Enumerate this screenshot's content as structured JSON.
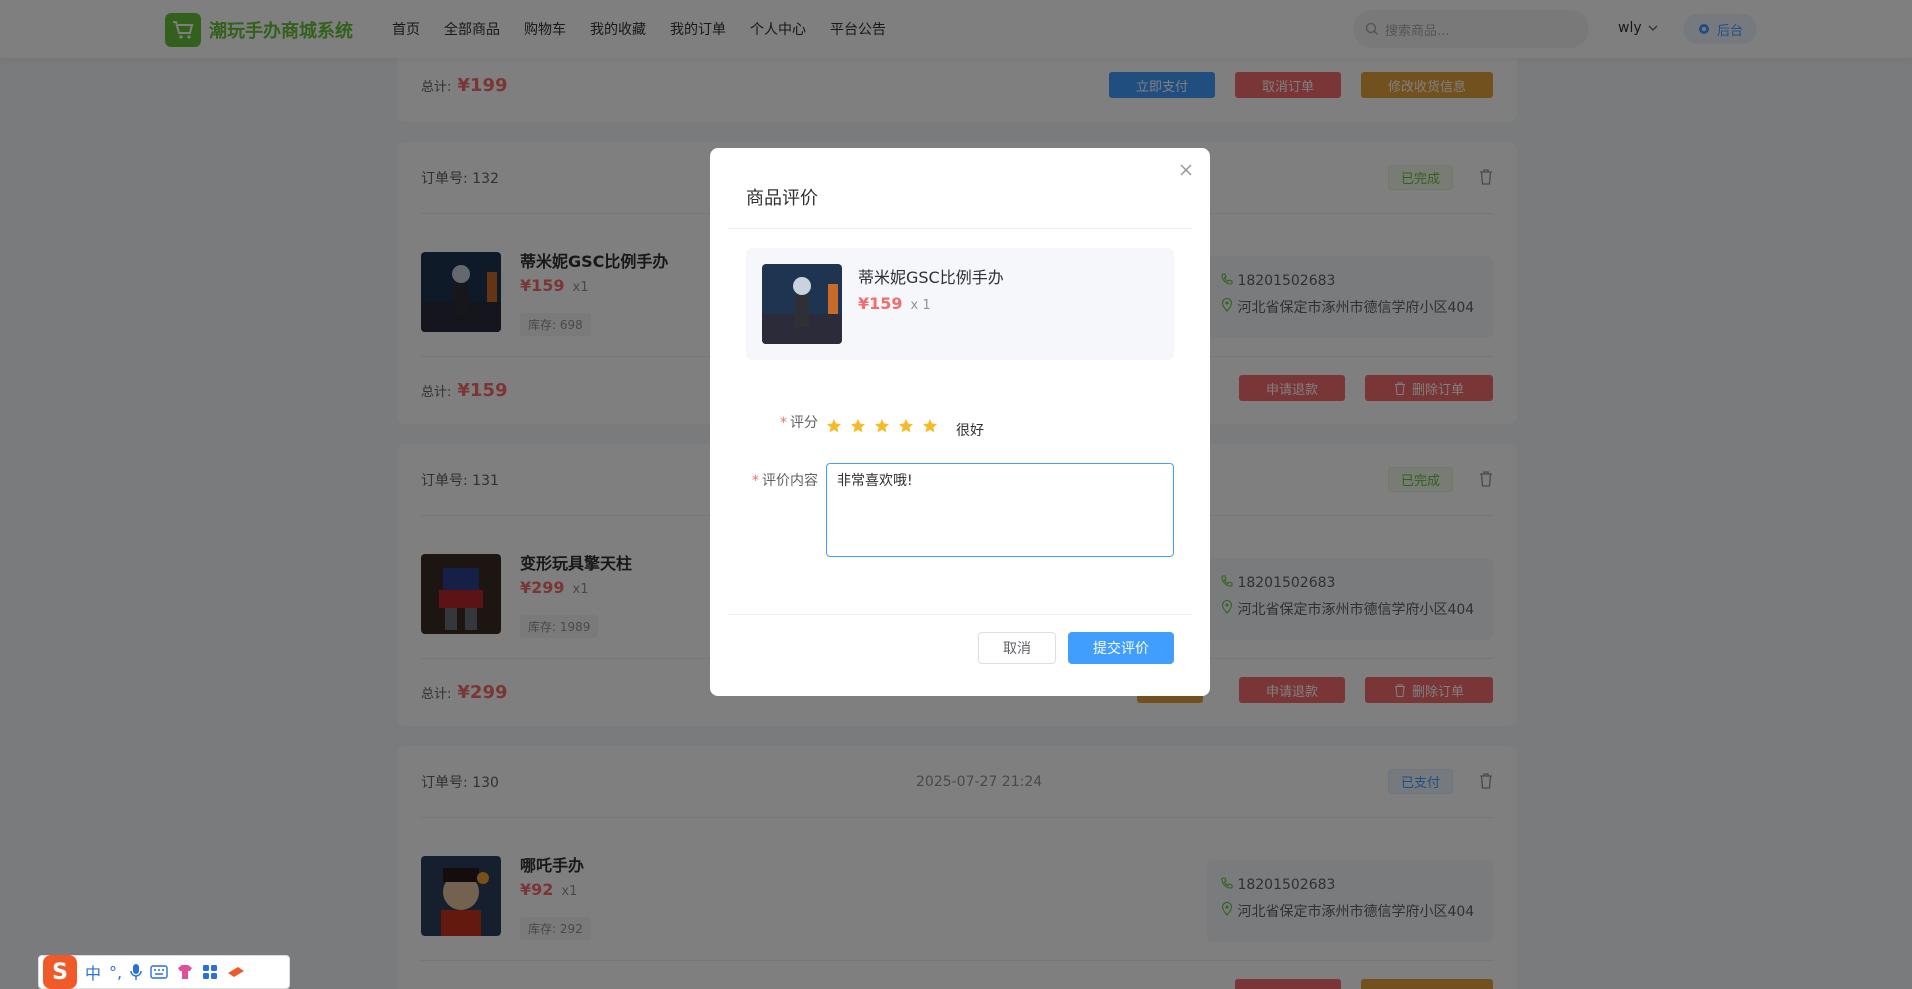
{
  "header": {
    "brand": "潮玩手办商城系统",
    "nav": [
      "首页",
      "全部商品",
      "购物车",
      "我的收藏",
      "我的订单",
      "个人中心",
      "平台公告"
    ],
    "search_placeholder": "搜索商品...",
    "username": "wly",
    "admin_label": "后台"
  },
  "orders": [
    {
      "total_label": "总计:",
      "total": "¥199",
      "actions": [
        "立即支付",
        "取消订单",
        "修改收货信息"
      ]
    },
    {
      "order_no": "订单号: 132",
      "status": "已完成",
      "product": "蒂米妮GSC比例手办",
      "price": "¥159",
      "qty": "x1",
      "stock": "库存: 698",
      "phone": "18201502683",
      "address": "河北省保定市涿州市德信学府小区404",
      "total_label": "总计:",
      "total": "¥159",
      "actions": [
        "申请退款",
        "删除订单"
      ]
    },
    {
      "order_no": "订单号: 131",
      "status": "已完成",
      "product": "变形玩具擎天柱",
      "price": "¥299",
      "qty": "x1",
      "stock": "库存: 1989",
      "phone": "18201502683",
      "address": "河北省保定市涿州市德信学府小区404",
      "total_label": "总计:",
      "total": "¥299",
      "actions": [
        "申请退款",
        "删除订单"
      ]
    },
    {
      "order_no": "订单号: 130",
      "time": "2025-07-27 21:24",
      "status": "已支付",
      "product": "哪吒手办",
      "price": "¥92",
      "qty": "x1",
      "stock": "库存: 292",
      "phone": "18201502683",
      "address": "河北省保定市涿州市德信学府小区404"
    }
  ],
  "dialog": {
    "title": "商品评价",
    "product_name": "蒂米妮GSC比例手办",
    "product_price": "¥159",
    "product_qty": "x 1",
    "rating_label": "评分",
    "rating_value": 5,
    "rating_max": 5,
    "rating_text": "很好",
    "content_label": "评价内容",
    "content_value": "非常喜欢哦!",
    "cancel": "取消",
    "submit": "提交评价"
  },
  "colors": {
    "brand": "#67c23a",
    "primary": "#409eff",
    "danger": "#f56c6c",
    "warning": "#e6a23c",
    "star": "#f7ba2a"
  },
  "ime": {
    "lang": "中"
  }
}
